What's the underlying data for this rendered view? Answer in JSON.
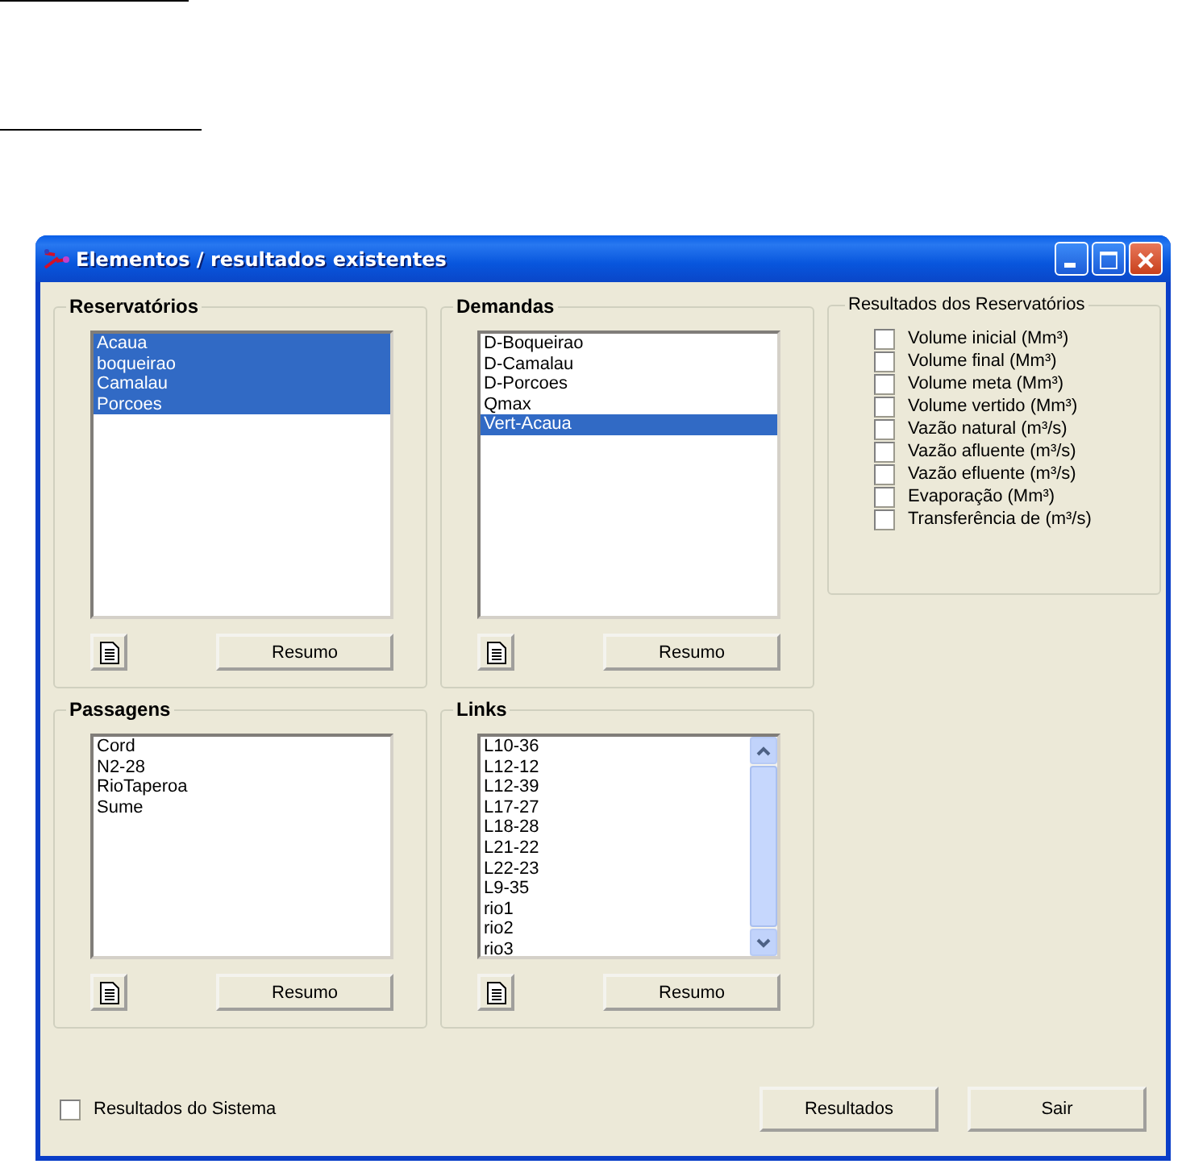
{
  "window": {
    "title": "Elementos / resultados existentes"
  },
  "panels": [
    {
      "title": "Reservatórios",
      "items": [
        {
          "label": "Acaua",
          "selected": true
        },
        {
          "label": "boqueirao",
          "selected": true
        },
        {
          "label": "Camalau",
          "selected": true
        },
        {
          "label": "Porcoes",
          "selected": true
        }
      ],
      "button": "Resumo",
      "scrollbar": false
    },
    {
      "title": "Demandas",
      "items": [
        {
          "label": "D-Boqueirao",
          "selected": false
        },
        {
          "label": "D-Camalau",
          "selected": false
        },
        {
          "label": "D-Porcoes",
          "selected": false
        },
        {
          "label": "Qmax",
          "selected": false
        },
        {
          "label": "Vert-Acaua",
          "selected": true
        }
      ],
      "button": "Resumo",
      "scrollbar": false
    },
    {
      "title": "Passagens",
      "items": [
        {
          "label": "Cord",
          "selected": false
        },
        {
          "label": "N2-28",
          "selected": false
        },
        {
          "label": "RioTaperoa",
          "selected": false
        },
        {
          "label": "Sume",
          "selected": false
        }
      ],
      "button": "Resumo",
      "scrollbar": false
    },
    {
      "title": "Links",
      "items": [
        {
          "label": "L10-36",
          "selected": false
        },
        {
          "label": "L12-12",
          "selected": false
        },
        {
          "label": "L12-39",
          "selected": false
        },
        {
          "label": "L17-27",
          "selected": false
        },
        {
          "label": "L18-28",
          "selected": false
        },
        {
          "label": "L21-22",
          "selected": false
        },
        {
          "label": "L22-23",
          "selected": false
        },
        {
          "label": "L9-35",
          "selected": false
        },
        {
          "label": "rio1",
          "selected": false
        },
        {
          "label": "rio2",
          "selected": false
        },
        {
          "label": "rio3",
          "selected": false
        }
      ],
      "button": "Resumo",
      "scrollbar": true
    }
  ],
  "results": {
    "title": "Resultados dos Reservatórios",
    "options": [
      {
        "label": "Volume inicial (Mm³)",
        "checked": false
      },
      {
        "label": "Volume final (Mm³)",
        "checked": false
      },
      {
        "label": "Volume meta (Mm³)",
        "checked": false
      },
      {
        "label": "Volume vertido (Mm³)",
        "checked": false
      },
      {
        "label": "Vazão natural (m³/s)",
        "checked": false
      },
      {
        "label": "Vazão afluente (m³/s)",
        "checked": false
      },
      {
        "label": "Vazão efluente (m³/s)",
        "checked": false
      },
      {
        "label": "Evaporação (Mm³)",
        "checked": false
      },
      {
        "label": "Transferência de (m³/s)",
        "checked": false
      }
    ]
  },
  "system_results": {
    "label": "Resultados do Sistema",
    "checked": false
  },
  "buttons": [
    "Resultados",
    "Sair"
  ]
}
